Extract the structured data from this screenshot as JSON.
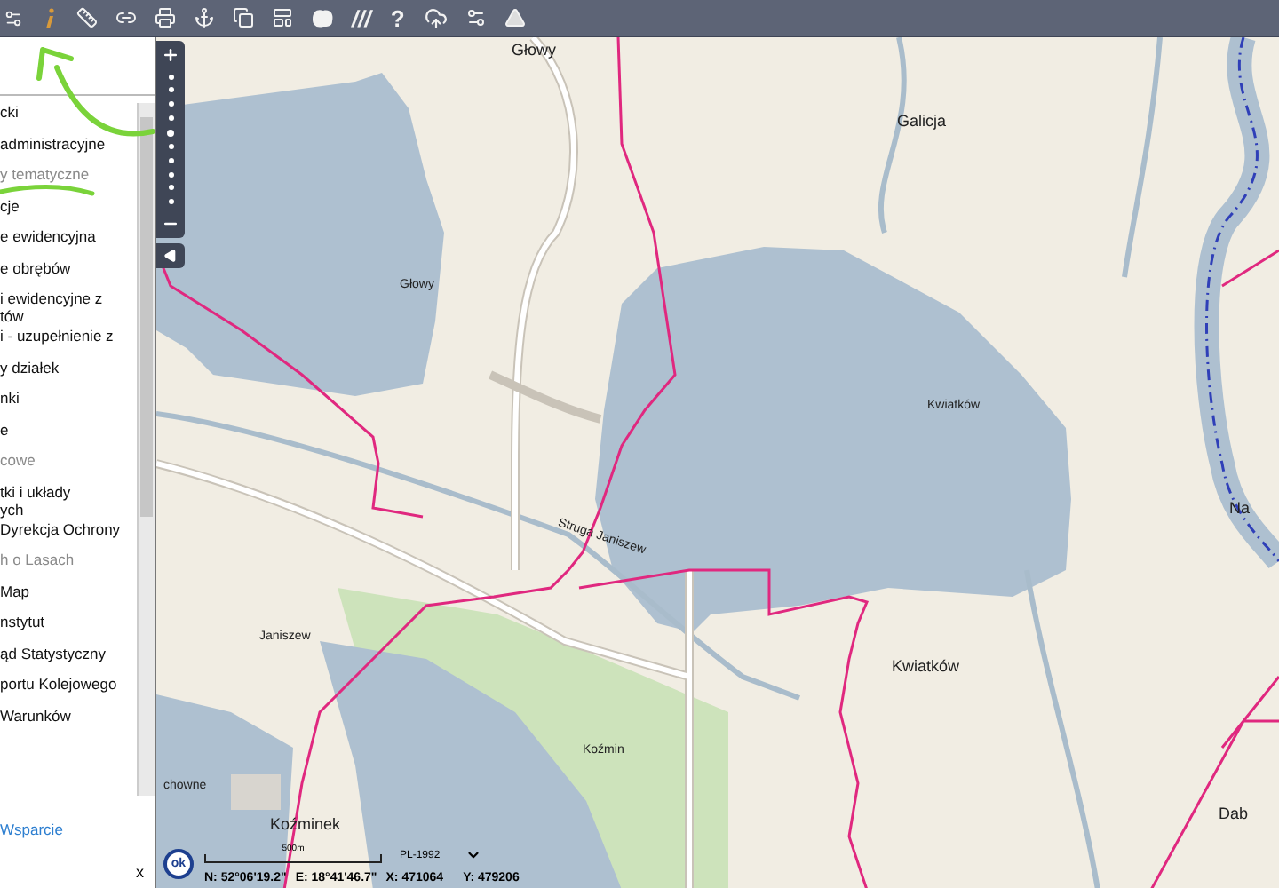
{
  "toolbar": {
    "hatch_label": "///",
    "help_label": "?"
  },
  "layers": [
    {
      "label": "cki",
      "kind": "layer"
    },
    {
      "label": "administracyjne",
      "kind": "layer"
    },
    {
      "label": "y tematyczne",
      "kind": "group"
    },
    {
      "label": "cje",
      "kind": "layer"
    },
    {
      "label": "e ewidencyjna",
      "kind": "layer"
    },
    {
      "label": "e obrębów",
      "kind": "layer"
    },
    {
      "label": "i ewidencyjne z\ntów",
      "kind": "layer"
    },
    {
      "label": "i - uzupełnienie z",
      "kind": "layer"
    },
    {
      "label": "y działek",
      "kind": "layer"
    },
    {
      "label": "nki",
      "kind": "layer"
    },
    {
      "label": "e",
      "kind": "layer"
    },
    {
      "label": "cowe",
      "kind": "group"
    },
    {
      "label": "tki i układy\nych",
      "kind": "layer"
    },
    {
      "label": "Dyrekcja Ochrony",
      "kind": "layer"
    },
    {
      "label": "h o Lasach",
      "kind": "group"
    },
    {
      "label": "Map",
      "kind": "layer"
    },
    {
      "label": "nstytut",
      "kind": "layer"
    },
    {
      "label": "ąd Statystyczny",
      "kind": "layer"
    },
    {
      "label": "portu Kolejowego",
      "kind": "layer"
    },
    {
      "label": "Warunków",
      "kind": "layer"
    }
  ],
  "panel_footer": {
    "link": "Wsparcie",
    "close": "x"
  },
  "map_labels": [
    {
      "text": "Głowy",
      "kind": "place"
    },
    {
      "text": "Głowy",
      "kind": "water"
    },
    {
      "text": "Galicja",
      "kind": "place"
    },
    {
      "text": "Kwiatków",
      "kind": "water"
    },
    {
      "text": "Struga Janiszew",
      "kind": "stream"
    },
    {
      "text": "Janiszew",
      "kind": "water"
    },
    {
      "text": "Kwiatków",
      "kind": "place"
    },
    {
      "text": "Koźmin",
      "kind": "water"
    },
    {
      "text": "chowne",
      "kind": "water"
    },
    {
      "text": "Koźminek",
      "kind": "place"
    },
    {
      "text": "Na",
      "kind": "place"
    },
    {
      "text": "Dab",
      "kind": "place"
    }
  ],
  "status": {
    "ok": "ok",
    "scale": "500m",
    "crs": "PL-1992",
    "n": "N: 52°06'19.2\"",
    "e": "E: 18°41'46.7\"",
    "x": "X: 471064",
    "y": "Y: 479206"
  }
}
